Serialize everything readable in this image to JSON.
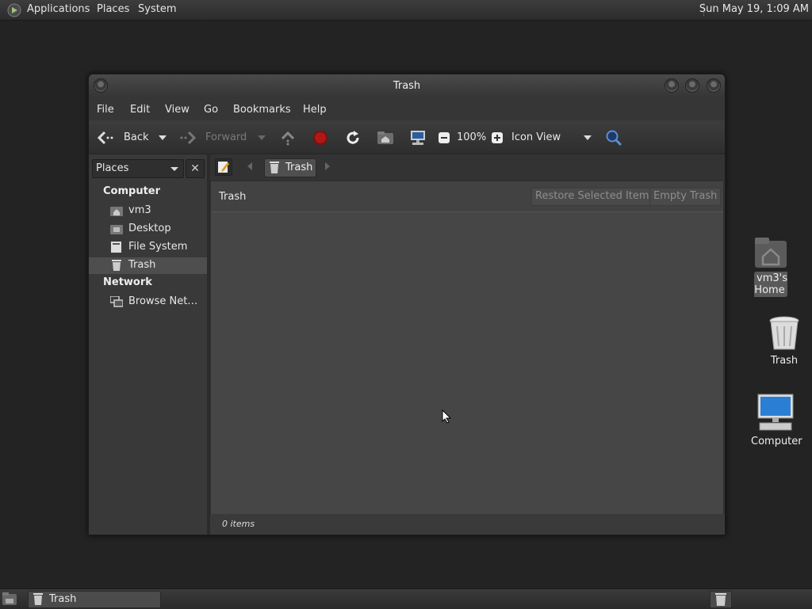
{
  "top_panel": {
    "menus": [
      "Applications",
      "Places",
      "System"
    ],
    "clock": "Sun May 19,  1:09 AM"
  },
  "window": {
    "title": "Trash",
    "menubar": [
      "File",
      "Edit",
      "View",
      "Go",
      "Bookmarks",
      "Help"
    ],
    "toolbar": {
      "back": "Back",
      "forward": "Forward",
      "zoom": "100%",
      "view_mode": "Icon View"
    },
    "sidebar": {
      "selector": "Places",
      "sections": [
        {
          "heading": "Computer",
          "items": [
            "vm3",
            "Desktop",
            "File System",
            "Trash"
          ]
        },
        {
          "heading": "Network",
          "items": [
            "Browse Net…"
          ]
        }
      ],
      "selected": "Trash"
    },
    "location": {
      "crumb": "Trash"
    },
    "info_bar": {
      "title": "Trash",
      "restore_button": "Restore Selected Items",
      "empty_button": "Empty Trash"
    },
    "status": "0 items"
  },
  "desktop": {
    "icons": [
      "vm3's Home",
      "Trash",
      "Computer"
    ]
  },
  "bottom_panel": {
    "task": "Trash"
  },
  "colors": {
    "desktop_bg": "#232323",
    "accent_stop": "#b01818",
    "computer_screen": "#2a7fd4"
  }
}
